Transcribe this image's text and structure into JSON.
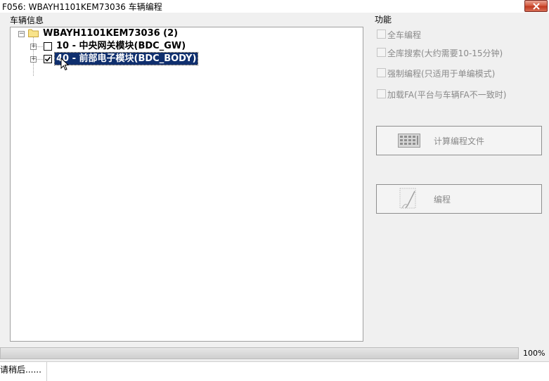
{
  "window": {
    "title": "F056: WBAYH1101KEM73036 车辆编程"
  },
  "vehicle_group": {
    "label": "车辆信息"
  },
  "tree": {
    "root": {
      "label": "WBAYH1101KEM73036 (2)"
    },
    "children": [
      {
        "label": "10 - 中央网关模块(BDC_GW)",
        "checked": false,
        "selected": false
      },
      {
        "label": "40 - 前部电子模块(BDC_BODY)",
        "checked": true,
        "selected": true
      }
    ]
  },
  "functions": {
    "label": "功能",
    "options": [
      {
        "label": "全车编程"
      },
      {
        "label": "全库搜索(大约需要10-15分钟)"
      },
      {
        "label": "强制编程(只适用于单编模式)"
      },
      {
        "label": "加载FA(平台与车辆FA不一致时)"
      }
    ],
    "calc_button": {
      "label": "计算编程文件"
    },
    "program_button": {
      "label": "编程"
    }
  },
  "progress": {
    "value": 100,
    "text": "100%"
  },
  "status": {
    "text": "请稍后......"
  },
  "icons": {
    "folder": "folder-icon",
    "calculator": "calculator-icon",
    "program": "program-document-icon",
    "close": "close-icon",
    "cursor": "mouse-cursor-icon"
  },
  "colors": {
    "selection": "#0f2f6e",
    "close_button": "#c13a21",
    "disabled_text": "#8a8a8a"
  }
}
